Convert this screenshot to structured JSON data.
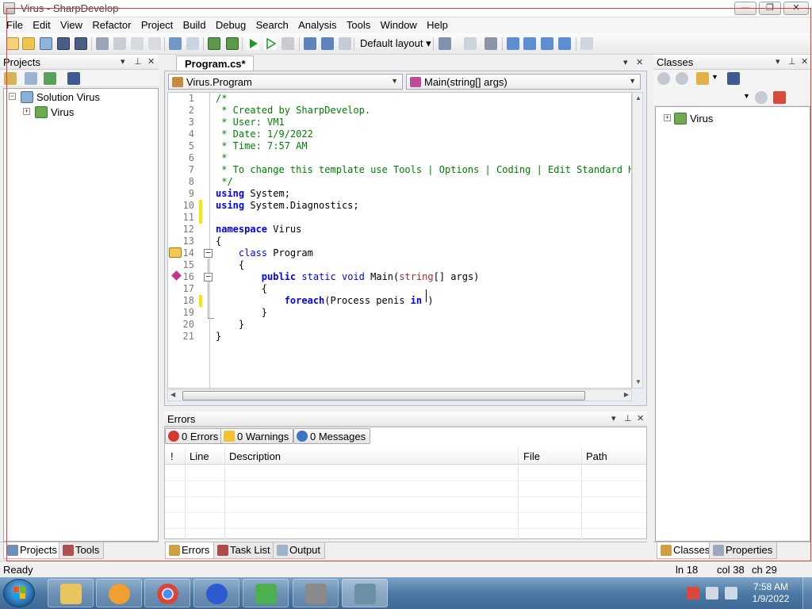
{
  "window": {
    "title": "Virus - SharpDevelop",
    "min_label": "—",
    "max_label": "❐",
    "close_label": "✕"
  },
  "menu": [
    "File",
    "Edit",
    "View",
    "Refactor",
    "Project",
    "Build",
    "Debug",
    "Search",
    "Analysis",
    "Tools",
    "Window",
    "Help"
  ],
  "toolbar": {
    "layout_label": "Default layout",
    "dropdown_arrow": "▾"
  },
  "projects_panel": {
    "title": "Projects",
    "tree": [
      {
        "label": "Solution Virus",
        "expander": "−"
      },
      {
        "label": "Virus",
        "expander": "+"
      }
    ],
    "tabs": [
      "Projects",
      "Tools"
    ]
  },
  "editor": {
    "tab_label": "Program.cs*",
    "class_combo": "Virus.Program",
    "member_combo": "Main(string[] args)",
    "line_numbers": [
      "1",
      "2",
      "3",
      "4",
      "5",
      "6",
      "7",
      "8",
      "9",
      "10",
      "11",
      "12",
      "13",
      "14",
      "15",
      "16",
      "17",
      "18",
      "19",
      "20",
      "21"
    ],
    "lines": [
      [
        {
          "t": "/*",
          "c": "cm"
        }
      ],
      [
        {
          "t": " * Created by SharpDevelop.",
          "c": "cm"
        }
      ],
      [
        {
          "t": " * User: VM1",
          "c": "cm"
        }
      ],
      [
        {
          "t": " * Date: 1/9/2022",
          "c": "cm"
        }
      ],
      [
        {
          "t": " * Time: 7:57 AM",
          "c": "cm"
        }
      ],
      [
        {
          "t": " *",
          "c": "cm"
        }
      ],
      [
        {
          "t": " * To change this template use Tools | Options | Coding | Edit Standard Hea",
          "c": "cm"
        }
      ],
      [
        {
          "t": " */",
          "c": "cm"
        }
      ],
      [
        {
          "t": "using",
          "c": "kw"
        },
        {
          "t": " System;",
          "c": ""
        }
      ],
      [
        {
          "t": "using",
          "c": "kw"
        },
        {
          "t": " System.Diagnostics;",
          "c": ""
        }
      ],
      [
        {
          "t": "",
          "c": ""
        }
      ],
      [
        {
          "t": "namespace",
          "c": "kw"
        },
        {
          "t": " Virus",
          "c": ""
        }
      ],
      [
        {
          "t": "{",
          "c": ""
        }
      ],
      [
        {
          "t": "    ",
          "c": ""
        },
        {
          "t": "class",
          "c": "kw2"
        },
        {
          "t": " Program",
          "c": ""
        }
      ],
      [
        {
          "t": "    {",
          "c": ""
        }
      ],
      [
        {
          "t": "        ",
          "c": ""
        },
        {
          "t": "public",
          "c": "kw"
        },
        {
          "t": " ",
          "c": ""
        },
        {
          "t": "static",
          "c": "kw2"
        },
        {
          "t": " ",
          "c": ""
        },
        {
          "t": "void",
          "c": "kw2"
        },
        {
          "t": " Main(",
          "c": ""
        },
        {
          "t": "string",
          "c": "ty"
        },
        {
          "t": "[] args)",
          "c": ""
        }
      ],
      [
        {
          "t": "        {",
          "c": ""
        }
      ],
      [
        {
          "t": "            ",
          "c": ""
        },
        {
          "t": "foreach",
          "c": "kw"
        },
        {
          "t": "(Process penis ",
          "c": ""
        },
        {
          "t": "in",
          "c": "kw"
        },
        {
          "t": " )",
          "c": ""
        }
      ],
      [
        {
          "t": "        }",
          "c": ""
        }
      ],
      [
        {
          "t": "    }",
          "c": ""
        }
      ],
      [
        {
          "t": "}",
          "c": ""
        }
      ]
    ]
  },
  "errors_panel": {
    "title": "Errors",
    "errors_btn": "0 Errors",
    "warnings_btn": "0 Warnings",
    "messages_btn": "0 Messages",
    "columns": [
      "!",
      "Line",
      "Description",
      "File",
      "Path"
    ],
    "tabs": [
      "Errors",
      "Task List",
      "Output"
    ]
  },
  "classes_panel": {
    "title": "Classes",
    "tree": [
      {
        "label": "Virus",
        "expander": "+"
      }
    ],
    "tabs": [
      "Classes",
      "Properties"
    ]
  },
  "panel_buttons": {
    "dropdown": "▾",
    "pin": "⊥",
    "close": "✕"
  },
  "status": {
    "ready": "Ready",
    "line": "ln 18",
    "col": "col 38",
    "ch": "ch 29"
  },
  "taskbar": {
    "time": "7:58 AM",
    "date": "1/9/2022"
  },
  "colors": {
    "accent_red": "#e23a3a",
    "taskbar": "#4c7aa6"
  }
}
